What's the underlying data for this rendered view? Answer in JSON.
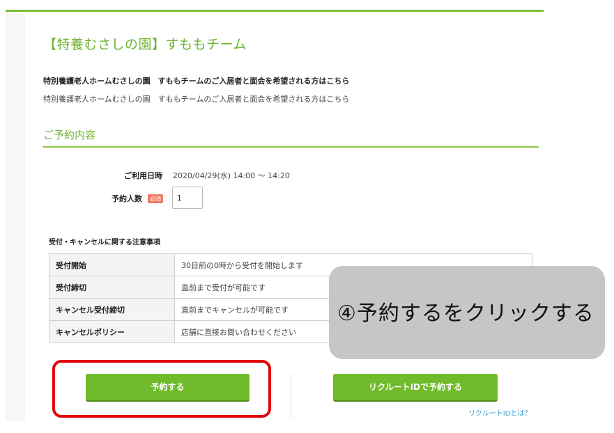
{
  "header": {
    "title": "【特養むさしの園】すももチーム",
    "subtitle_bold": "特別養護老人ホームむさしの園　すももチームのご入居者と面会を希望される方はこちら",
    "subtitle": "特別養護老人ホームむさしの園　すももチームのご入居者と面会を希望される方はこちら"
  },
  "reservation": {
    "section_title": "ご予約内容",
    "datetime_label": "ご利用日時",
    "datetime_value": "2020/04/29(水) 14:00 ～ 14:20",
    "people_label": "予約人数",
    "required_badge": "必須",
    "people_value": "1"
  },
  "notes": {
    "title": "受付・キャンセルに関する注意事項",
    "rows": [
      {
        "label": "受付開始",
        "value": "30日前の0時から受付を開始します"
      },
      {
        "label": "受付締切",
        "value": "直前まで受付が可能です"
      },
      {
        "label": "キャンセル受付締切",
        "value": "直前までキャンセルが可能です"
      },
      {
        "label": "キャンセルポリシー",
        "value": "店舗に直接お問い合わせください"
      }
    ]
  },
  "actions": {
    "reserve_label": "予約する",
    "recruit_label": "リクルートIDで予約する",
    "recruit_link": "リクルートIDとは？"
  },
  "overlay": {
    "instruction": "④予約するをクリックする"
  },
  "colors": {
    "accent": "#6cb32f",
    "button": "#70bb2c",
    "highlight": "#e40000",
    "badge": "#f07a5f"
  }
}
